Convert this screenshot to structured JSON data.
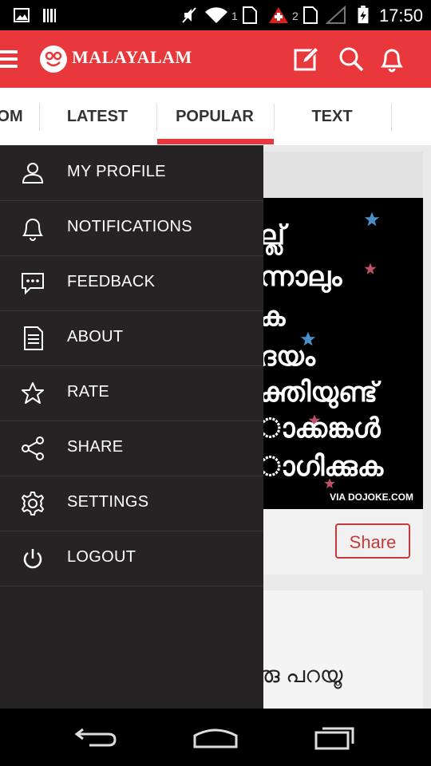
{
  "status_bar": {
    "time": "17:50",
    "sim1": "1",
    "sim2": "2"
  },
  "app_bar": {
    "brand": "MALAYALAM"
  },
  "tabs": [
    {
      "label": "OM"
    },
    {
      "label": "LATEST"
    },
    {
      "label": "POPULAR",
      "active": true
    },
    {
      "label": "TEXT"
    }
  ],
  "drawer": {
    "items": [
      {
        "label": "MY PROFILE",
        "icon": "profile-icon"
      },
      {
        "label": "NOTIFICATIONS",
        "icon": "bell-icon"
      },
      {
        "label": "FEEDBACK",
        "icon": "feedback-icon"
      },
      {
        "label": "ABOUT",
        "icon": "document-icon"
      },
      {
        "label": "RATE",
        "icon": "star-icon"
      },
      {
        "label": "SHARE",
        "icon": "share-icon"
      },
      {
        "label": "SETTINGS",
        "icon": "gear-icon"
      },
      {
        "label": "LOGOUT",
        "icon": "power-icon"
      }
    ]
  },
  "post": {
    "image_lines": [
      "ല്ല്",
      "ന്നാലും",
      "ക",
      "ദയം",
      "ക്തിയുണ്ട്",
      "ാക്കങ്കൾ",
      "ാഗിക്കുക"
    ],
    "watermark": "VIA DOJOKE.COM",
    "share_label": "Share"
  },
  "post2": {
    "text": "രു പറയൂ"
  },
  "colors": {
    "accent": "#e8383b",
    "drawer_bg": "#262324"
  }
}
